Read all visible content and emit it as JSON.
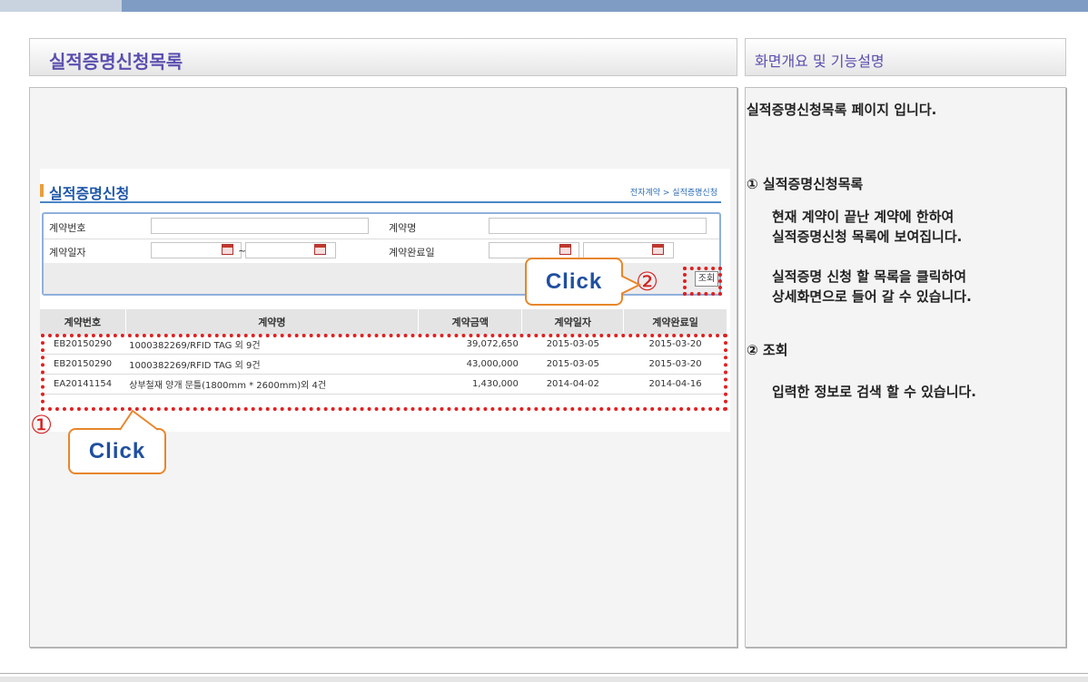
{
  "header": {
    "left_title": "실적증명신청목록",
    "right_title": "화면개요 및 기능설명"
  },
  "screen": {
    "section_title": "실적증명신청",
    "breadcrumb": "전자계약 > 실적증명신청",
    "search": {
      "contract_no_label": "계약번호",
      "contract_name_label": "계약명",
      "contract_date_label": "계약일자",
      "completion_date_label": "계약완료일",
      "range_sep": "~",
      "search_button": "조회"
    },
    "table": {
      "headers": [
        "계약번호",
        "계약명",
        "계약금액",
        "계약일자",
        "계약완료일"
      ],
      "rows": [
        [
          "EB20150290",
          "1000382269/RFID TAG 외 9건",
          "39,072,650",
          "2015-03-05",
          "2015-03-20"
        ],
        [
          "EB20150290",
          "1000382269/RFID TAG 외 9건",
          "43,000,000",
          "2015-03-05",
          "2015-03-20"
        ],
        [
          "EA20141154",
          "상부철재 양개 문틀(1800mm * 2600mm)외 4건",
          "1,430,000",
          "2014-04-02",
          "2014-04-16"
        ]
      ]
    }
  },
  "annotations": {
    "marker1": "①",
    "marker2": "②",
    "click1": "Click",
    "click2": "Click"
  },
  "description": {
    "intro": "실적증명신청목록 페이지 입니다.",
    "item1_title": "① 실적증명신청목록",
    "item1_line1": "현재 계약이 끝난 계약에 한하여",
    "item1_line2": "실적증명신청 목록에 보여집니다.",
    "item1_line3": "실적증명 신청 할 목록을 클릭하여",
    "item1_line4": "상세화면으로 들어 갈 수 있습니다.",
    "item2_title": "② 조회",
    "item2_line1": "입력한 정보로 검색 할 수 있습니다."
  }
}
